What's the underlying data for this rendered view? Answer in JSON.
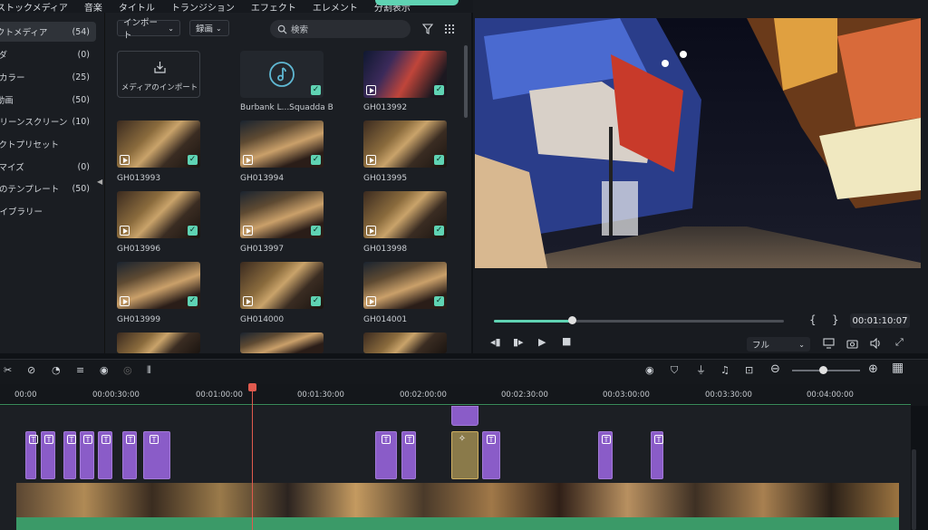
{
  "menu": [
    "ストックメディア",
    "音楽",
    "タイトル",
    "トランジション",
    "エフェクト",
    "エレメント",
    "分割表示"
  ],
  "sidebar": [
    {
      "label": "プロジェクトメディア",
      "count": "(54)",
      "active": true
    },
    {
      "label": "フォルダ",
      "count": "(0)"
    },
    {
      "label": "カラー",
      "count": "(25)"
    },
    {
      "label": "サンプル動画",
      "count": "(50)"
    },
    {
      "label": "グリーンスクリーン",
      "count": "(10)"
    },
    {
      "label": "エフェクトプリセット",
      "count": ""
    },
    {
      "label": "カスタマイズ",
      "count": "(0)"
    },
    {
      "label": "動画のテンプレート",
      "count": "(50)"
    },
    {
      "label": "ライブラリー",
      "count": ""
    }
  ],
  "media": {
    "import_dropdown": "インポート",
    "record_dropdown": "録画",
    "search_placeholder": "検索",
    "import_tile_label": "メディアのインポート",
    "items": [
      {
        "name": "Burbank L...Squadda B",
        "type": "audio"
      },
      {
        "name": "GH013992"
      },
      {
        "name": "GH013993"
      },
      {
        "name": "GH013994"
      },
      {
        "name": "GH013995"
      },
      {
        "name": "GH013996"
      },
      {
        "name": "GH013997"
      },
      {
        "name": "GH013998"
      },
      {
        "name": "GH013999"
      },
      {
        "name": "GH014000"
      },
      {
        "name": "GH014001"
      }
    ]
  },
  "preview": {
    "timecode": "00:01:10:07",
    "quality": "フル",
    "progress": 0.27,
    "bracket_in": "{",
    "bracket_out": "}"
  },
  "timeline": {
    "ruler": [
      "00:00",
      "00:00:30:00",
      "00:01:00:00",
      "00:01:30:00",
      "00:02:00:00",
      "00:02:30:00",
      "00:03:00:00",
      "00:03:30:00",
      "00:04:00:00"
    ],
    "zoom": 0.45
  },
  "colors": {
    "accent": "#5fd3b3",
    "playhead": "#e05a4e",
    "title_clip": "#8a5cc8",
    "audio": "#3b9a68"
  }
}
